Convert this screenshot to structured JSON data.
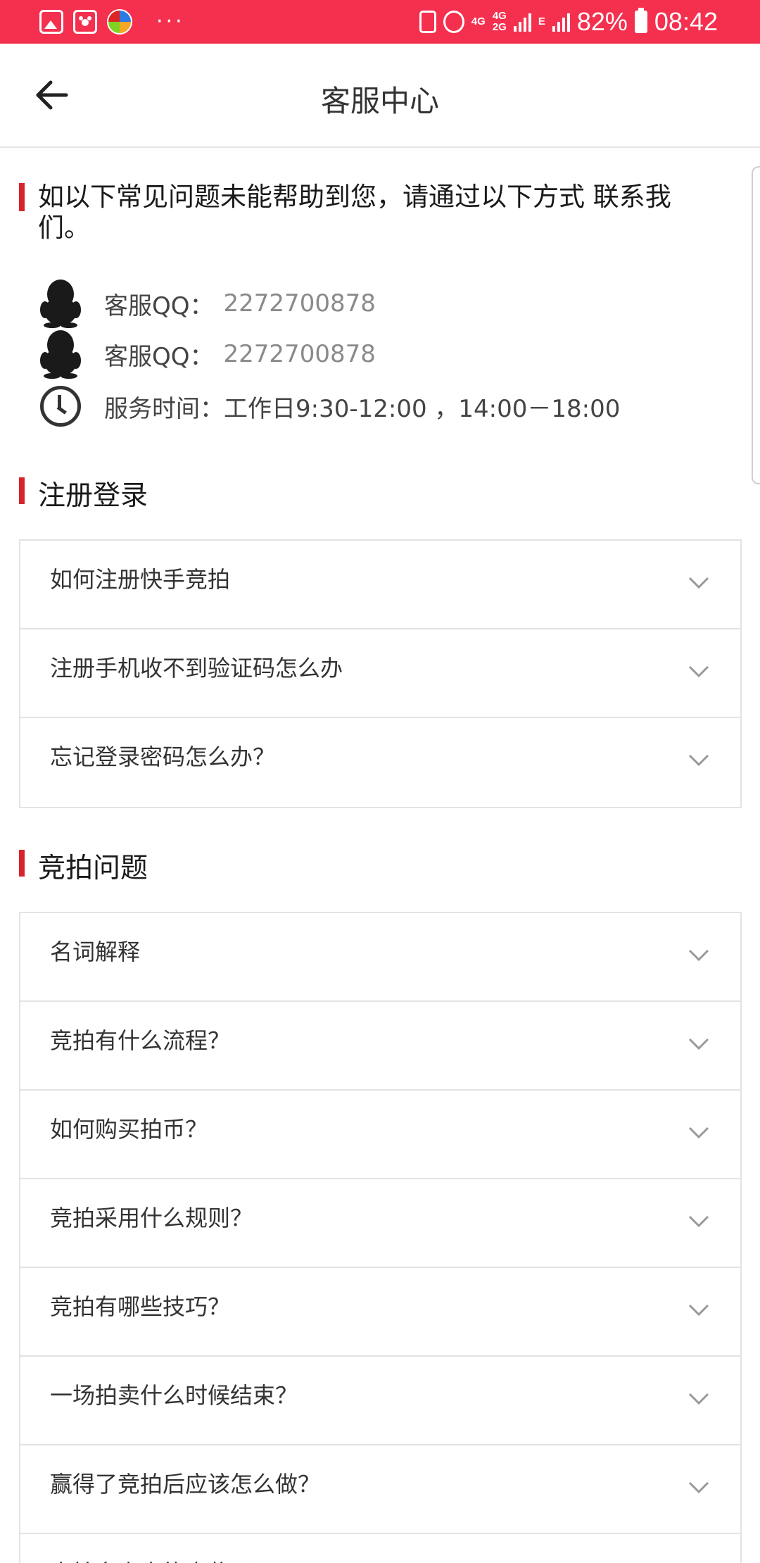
{
  "status_bar": {
    "left_icons": [
      "gallery-icon",
      "baidu-paw-icon",
      "ball-app-icon",
      "more-dots-icon"
    ],
    "network_1": "4G",
    "network_2a": "4G",
    "network_2b": "2G",
    "network_3": "E",
    "battery": "82%",
    "time": "08:42",
    "overflow": "···"
  },
  "header": {
    "title": "客服中心",
    "back_icon": "arrow-left-icon"
  },
  "intro": {
    "text": "如以下常见问题未能帮助到您，请通过以下方式 联系我们。",
    "contacts": [
      {
        "label": "客服QQ：",
        "value": "2272700878",
        "icon": "qq-penguin-icon"
      },
      {
        "label": "客服QQ：",
        "value": "2272700878",
        "icon": "qq-penguin-icon"
      },
      {
        "label": "服务时间：工作日9:30-12:00 ，14:00－18:00",
        "value": "",
        "icon": "clock-icon"
      }
    ]
  },
  "sections": [
    {
      "title": "注册登录",
      "items": [
        "如何注册快手竞拍",
        "注册手机收不到验证码怎么办",
        "忘记登录密码怎么办？"
      ]
    },
    {
      "title": "竞拍问题",
      "items": [
        "名词解释",
        "竞拍有什么流程？",
        "如何购买拍币？",
        "竞拍采用什么规则？",
        "竞拍有哪些技巧？",
        "一场拍卖什么时候结束？",
        "赢得了竞拍后应该怎么做？",
        "竞拍多少次能中奖吗"
      ]
    }
  ],
  "colors": {
    "status_bar": "#f5304f",
    "accent_bar": "#d8232a",
    "border": "#e3e3e3",
    "muted_text": "#8a8a8a"
  }
}
